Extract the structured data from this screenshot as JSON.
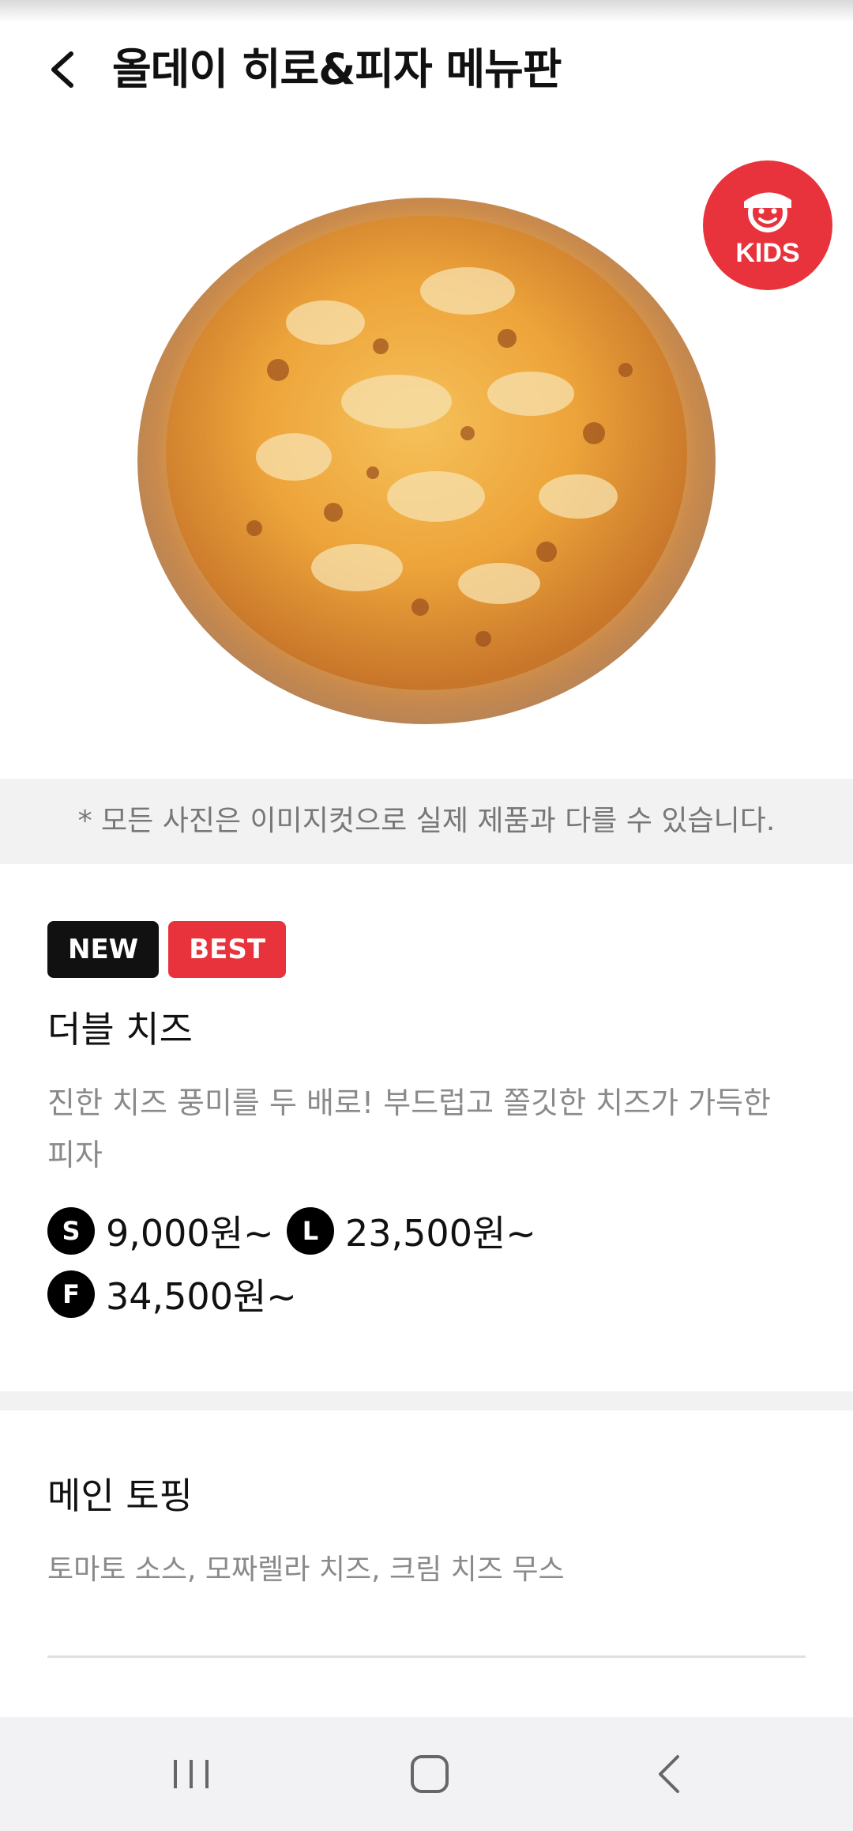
{
  "header": {
    "title": "올데이 히로&피자 메뉴판",
    "back_icon": "chevron-left-icon"
  },
  "hero": {
    "image": "pizza-photo",
    "kids_label": "KIDS",
    "kids_color": "#e8333c"
  },
  "notice": "* 모든 사진은 이미지컷으로 실제 제품과 다를 수 있습니다.",
  "product": {
    "badges": [
      {
        "label": "NEW",
        "color": "#111111"
      },
      {
        "label": "BEST",
        "color": "#e8333c"
      }
    ],
    "name": "더블 치즈",
    "description": "진한 치즈 풍미를 두 배로! 부드럽고 쫄깃한 치즈가 가득한 피자",
    "prices": [
      {
        "size": "S",
        "price": "9,000원~"
      },
      {
        "size": "L",
        "price": "23,500원~"
      },
      {
        "size": "F",
        "price": "34,500원~"
      }
    ]
  },
  "topping": {
    "title": "메인 토핑",
    "items": "토마토 소스, 모짜렐라 치즈, 크림 치즈 무스"
  },
  "navbar": {
    "recents_icon": "recents-icon",
    "home_icon": "home-icon",
    "back_icon": "back-icon"
  }
}
